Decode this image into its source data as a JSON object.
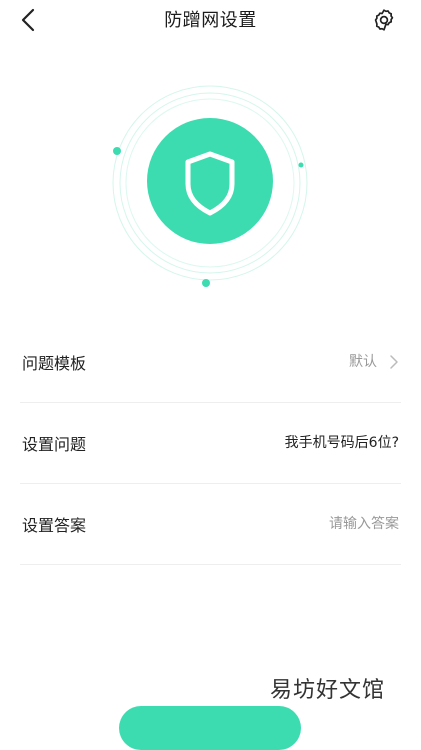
{
  "header": {
    "title": "防蹭网设置",
    "back_icon": "chevron-left-icon",
    "settings_icon": "gear-icon"
  },
  "emblem": {
    "icon": "shield-icon",
    "accent_color": "#3ddcb0"
  },
  "settings": {
    "rows": [
      {
        "label": "问题模板",
        "value": "默认",
        "has_arrow": true
      },
      {
        "label": "设置问题",
        "value": "我手机号码后6位?"
      },
      {
        "label": "设置答案",
        "placeholder": "请输入答案"
      }
    ]
  },
  "watermark": "易坊好文馆",
  "colors": {
    "accent": "#3ddcb0",
    "text": "#222222",
    "muted": "#999999",
    "divider": "#eeeeee"
  }
}
